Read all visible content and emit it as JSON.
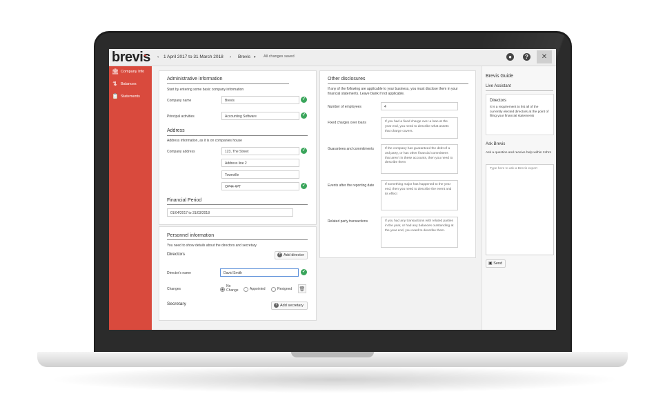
{
  "app": {
    "logo": "brevis",
    "logo_mark": "+"
  },
  "topbar": {
    "back_arrow": "‹",
    "period": "1 April 2017 to 31 March 2018",
    "separator": "›",
    "company": "Brevis",
    "company_caret": "▾",
    "status": "All changes saved",
    "user_icon": "user-circle-icon",
    "help_icon": "help-icon",
    "close_symbol": "✕"
  },
  "sidebar": {
    "items": [
      {
        "label": "Company Info",
        "icon": "bank-icon",
        "glyph": "🏛"
      },
      {
        "label": "Balances",
        "icon": "sort-icon",
        "glyph": "⇅"
      },
      {
        "label": "Statements",
        "icon": "clipboard-icon",
        "glyph": "📋"
      }
    ]
  },
  "admin": {
    "title": "Administrative information",
    "intro": "Start by entering some basic company information",
    "company_name_label": "Company name",
    "company_name_value": "Brevis",
    "principal_label": "Principal activities",
    "principal_value": "Accounting Software"
  },
  "address": {
    "title": "Address",
    "intro": "Address information, as it is on companies house",
    "label": "Company address",
    "line1": "123, The Street",
    "line2_placeholder": "Address line 2",
    "town": "Townville",
    "postcode": "OP44 4PT"
  },
  "financial": {
    "title": "Financial Period",
    "value": "01/04/2017 to 31/03/2018"
  },
  "personnel": {
    "title": "Personnel information",
    "intro": "You need to show details about the directors and secretary",
    "directors_heading": "Directors",
    "add_director": "Add director",
    "director_name_label": "Director's name",
    "director_name_value": "David Smith",
    "changes_label": "Changes",
    "options": [
      "No Change",
      "Appointed",
      "Resigned"
    ],
    "selected": "No Change",
    "secretary_heading": "Secretary",
    "add_secretary": "Add secretary"
  },
  "other": {
    "title": "Other disclosures",
    "intro": "If any of the following are applicable to your business, you must disclose them in your financial statements. Leave blank if not applicable.",
    "employees_label": "Number of employees",
    "employees_value": "4",
    "fixed_label": "Fixed charges over loans",
    "fixed_placeholder": "If you had a fixed charge over a loan at the year end, you need to describe what assets that charge covers.",
    "guarantees_label": "Guarantees and commitments",
    "guarantees_placeholder": "If the company has guaranteed the debt of a 3rd party, or has other financial committees that aren't in these accounts, then you need to describe them",
    "events_label": "Events after the reporting date",
    "events_placeholder": "If something major has happened to the year end, then you need to describe the event and its effect",
    "related_label": "Related party transactions",
    "related_placeholder": "If you had any transactions with related parties in the year, or had any balances outstanding at the year end, you need to describe them."
  },
  "guide": {
    "title": "Brevis Guide",
    "assistant_heading": "Live Assistant",
    "topic": "Directors",
    "topic_text": "It is a requirement to list all of the currently elected directors at the point of filing your financial statements",
    "ask_heading": "Ask Brevis",
    "ask_intro": "Ask a question and receive help within 24hrs",
    "ask_placeholder": "Type here to ask a Brevis expert",
    "send_label": "Send"
  },
  "colors": {
    "brand_red": "#d94a3d",
    "check_green": "#3aa55b"
  }
}
